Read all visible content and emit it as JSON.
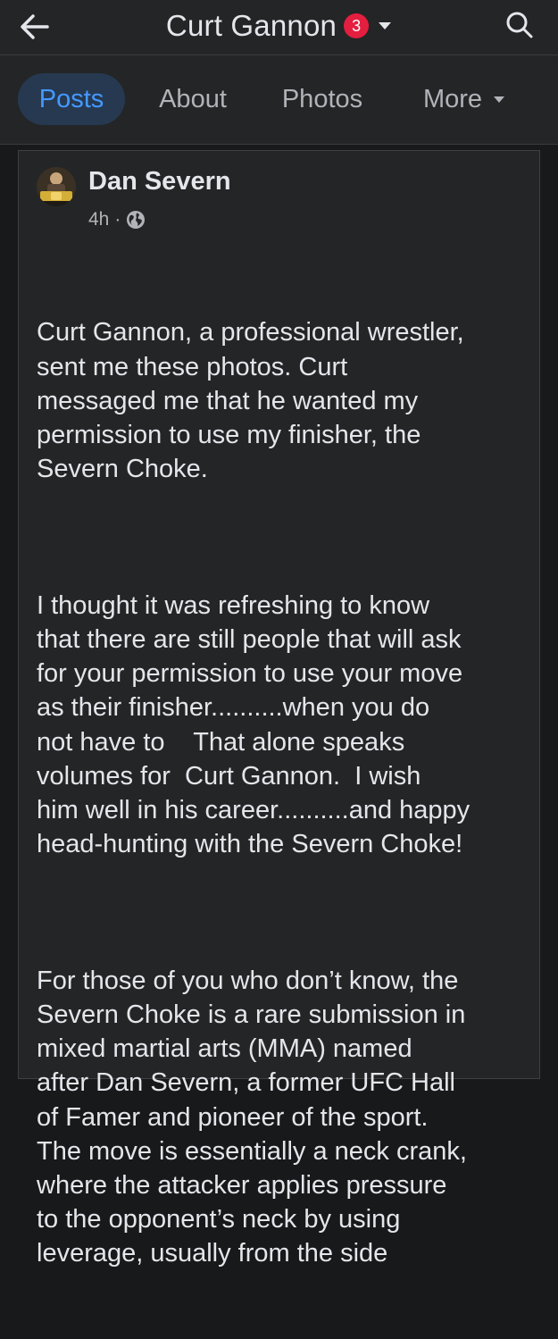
{
  "header": {
    "title": "Curt Gannon",
    "badge_count": "3",
    "back_icon": "arrow-left-icon",
    "search_icon": "search-icon"
  },
  "tabs": [
    {
      "label": "Posts",
      "active": true
    },
    {
      "label": "About",
      "active": false
    },
    {
      "label": "Photos",
      "active": false
    },
    {
      "label": "More",
      "active": false
    }
  ],
  "post": {
    "author": "Dan Severn",
    "time": "4h",
    "separator": "·",
    "privacy_icon": "globe-icon",
    "paragraphs": [
      "Curt Gannon, a professional wrestler,\nsent me these photos. Curt\nmessaged me that he wanted my\npermission to use my finisher, the\nSevern Choke.",
      "I thought it was refreshing to know\nthat there are still people that will ask\nfor your permission to use your move\nas their finisher..........when you do\nnot have to    That alone speaks\nvolumes for  Curt Gannon.  I wish\nhim well in his career..........and happy\nhead-hunting with the Severn Choke!",
      "For those of you who don’t know, the\nSevern Choke is a rare submission in\nmixed martial arts (MMA) named\nafter Dan Severn, a former UFC Hall\nof Famer and pioneer of the sport.\nThe move is essentially a neck crank,\nwhere the attacker applies pressure\nto the opponent’s neck by using\nleverage, usually from the side"
    ]
  },
  "colors": {
    "background": "#18191a",
    "surface": "#242526",
    "accent": "#4599ff",
    "active_tab_bg": "#263951",
    "badge": "#e41e3f",
    "text_primary": "#e4e6eb",
    "text_secondary": "#b0b3b8"
  }
}
